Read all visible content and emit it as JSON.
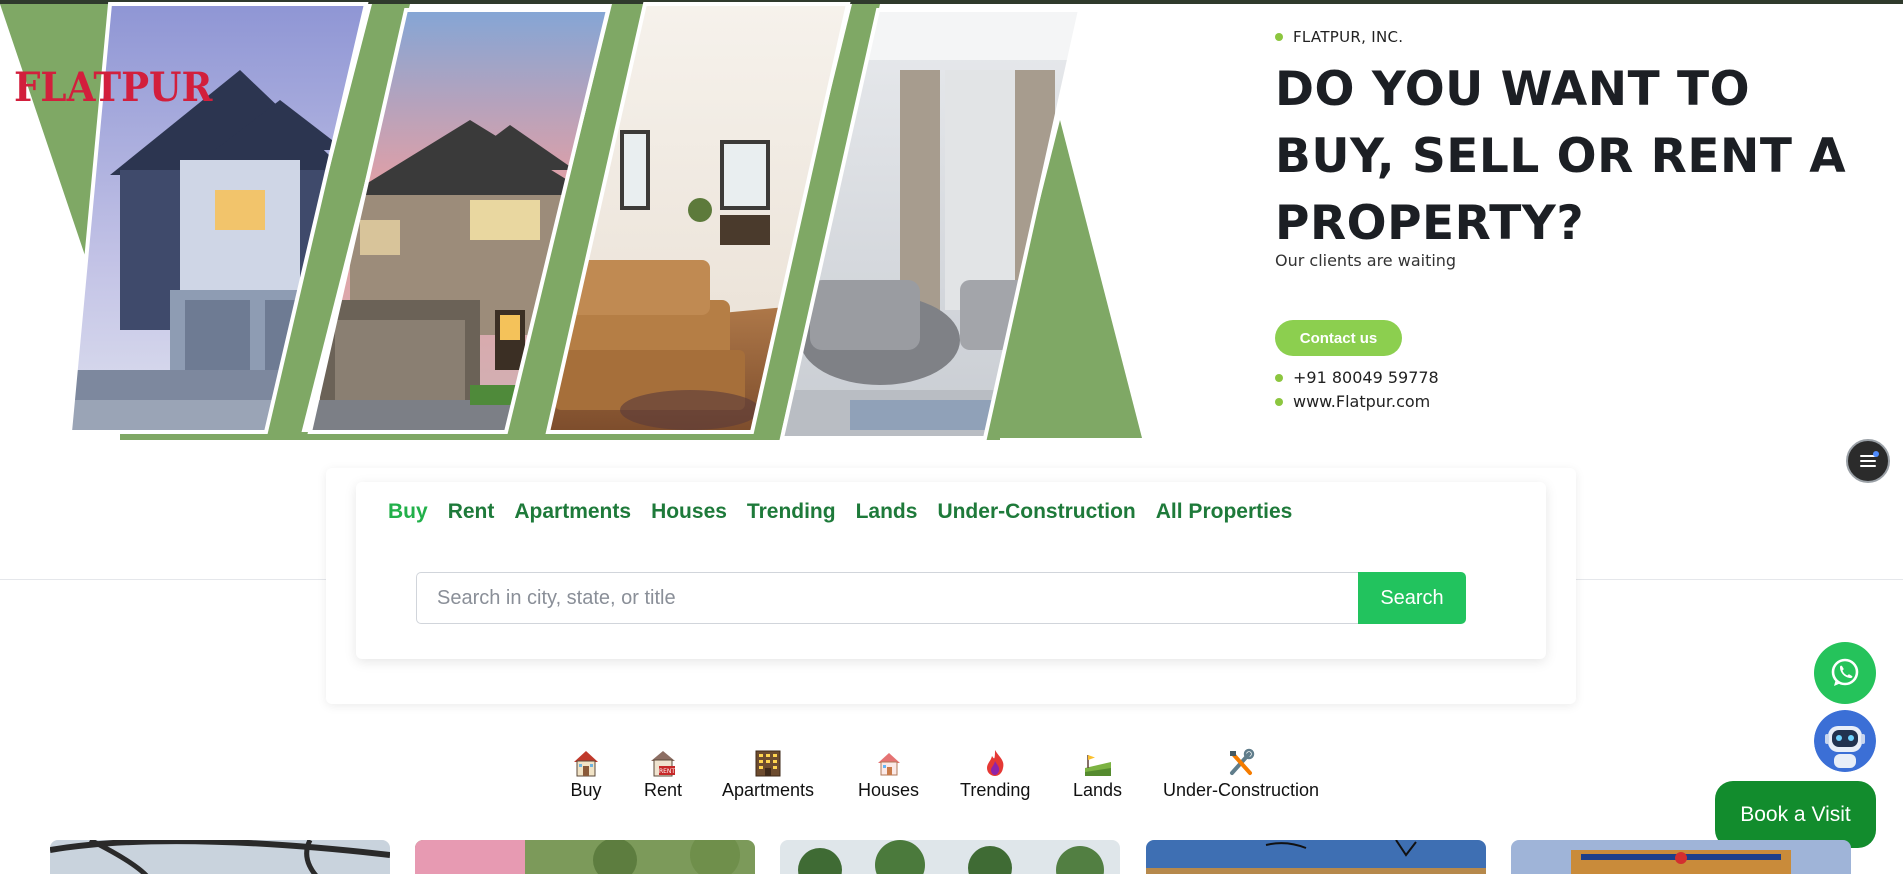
{
  "brand": {
    "logo_text": "FLATPUR"
  },
  "hero": {
    "company": "FLATPUR, INC.",
    "headline_lines": [
      "DO YOU WANT TO",
      "BUY, SELL OR RENT A",
      "PROPERTY?"
    ],
    "subline": "Our clients are waiting",
    "contact_button": "Contact us",
    "phone": "+91 80049 59778",
    "website": "www.Flatpur.com"
  },
  "search": {
    "tabs": [
      {
        "label": "Buy",
        "active": true
      },
      {
        "label": "Rent"
      },
      {
        "label": "Apartments"
      },
      {
        "label": "Houses"
      },
      {
        "label": "Trending"
      },
      {
        "label": "Lands"
      },
      {
        "label": "Under-Construction"
      },
      {
        "label": "All Properties"
      }
    ],
    "placeholder": "Search in city, state, or title",
    "button": "Search"
  },
  "categories": [
    {
      "label": "Buy",
      "icon": "house-icon"
    },
    {
      "label": "Rent",
      "icon": "rent-house-icon"
    },
    {
      "label": "Apartments",
      "icon": "apartment-building-icon"
    },
    {
      "label": "Houses",
      "icon": "small-house-icon"
    },
    {
      "label": "Trending",
      "icon": "fire-icon"
    },
    {
      "label": "Lands",
      "icon": "land-icon"
    },
    {
      "label": "Under-Construction",
      "icon": "tools-icon"
    }
  ],
  "floating": {
    "whatsapp_icon": "whatsapp-icon",
    "chatbot_icon": "robot-icon",
    "book_visit": "Book a Visit"
  },
  "colors": {
    "brand_red": "#d21f3c",
    "hero_green": "#7fa865",
    "accent_green": "#8ccf4f",
    "tab_green": "#1e7a3a",
    "tab_active": "#22b04a",
    "search_btn": "#22c35e",
    "whatsapp": "#25c35b",
    "book_btn": "#128c2d"
  }
}
